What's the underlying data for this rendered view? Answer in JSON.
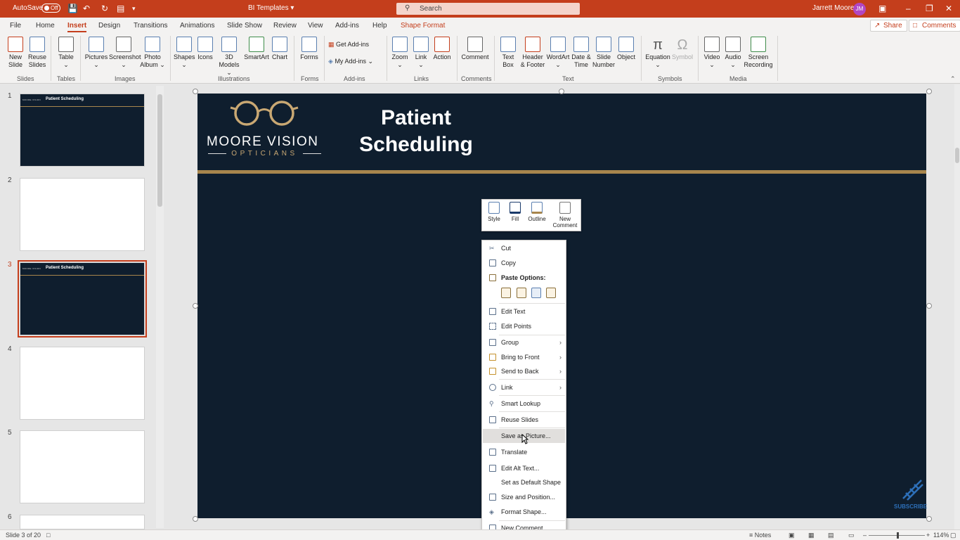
{
  "titlebar": {
    "autosave_label": "AutoSave",
    "autosave_state": "Off",
    "doc_title": "BI Templates",
    "search_placeholder": "Search",
    "user_name": "Jarrett Moore",
    "user_initials": "JM"
  },
  "tabs": [
    "File",
    "Home",
    "Insert",
    "Design",
    "Transitions",
    "Animations",
    "Slide Show",
    "Review",
    "View",
    "Add-ins",
    "Help",
    "Shape Format"
  ],
  "active_tab": "Insert",
  "top_actions": {
    "share": "Share",
    "comments": "Comments"
  },
  "ribbon": {
    "new_slide": [
      "New",
      "Slide"
    ],
    "reuse_slides": [
      "Reuse",
      "Slides"
    ],
    "table": "Table",
    "pictures": "Pictures",
    "screenshot": "Screenshot",
    "photo_album": [
      "Photo",
      "Album"
    ],
    "shapes": "Shapes",
    "icons": "Icons",
    "models": [
      "3D",
      "Models"
    ],
    "smartart": "SmartArt",
    "chart": "Chart",
    "forms": "Forms",
    "get_addins": "Get Add-ins",
    "my_addins": "My Add-ins",
    "zoom": "Zoom",
    "link": "Link",
    "action": "Action",
    "comment": "Comment",
    "text_box": [
      "Text",
      "Box"
    ],
    "header_footer": [
      "Header",
      "& Footer"
    ],
    "wordart": "WordArt",
    "date_time": [
      "Date &",
      "Time"
    ],
    "slide_number": [
      "Slide",
      "Number"
    ],
    "object": "Object",
    "equation": "Equation",
    "symbol": "Symbol",
    "video": "Video",
    "audio": "Audio",
    "screen_recording": [
      "Screen",
      "Recording"
    ],
    "groups": {
      "slides": "Slides",
      "tables": "Tables",
      "images": "Images",
      "illustrations": "Illustrations",
      "forms": "Forms",
      "addins": "Add-ins",
      "links": "Links",
      "comments": "Comments",
      "text": "Text",
      "symbols": "Symbols",
      "media": "Media"
    }
  },
  "thumbnails": [
    {
      "num": "1",
      "title": "Patient Scheduling"
    },
    {
      "num": "2"
    },
    {
      "num": "3",
      "title": "Patient Scheduling"
    },
    {
      "num": "4"
    },
    {
      "num": "5"
    },
    {
      "num": "6"
    }
  ],
  "slide": {
    "title_line1": "Patient",
    "title_line2": "Scheduling",
    "brand_line1": "MOORE VISION",
    "brand_line2": "OPTICIANS",
    "subscribe": "SUBSCRIBE"
  },
  "mini_toolbar": {
    "style": "Style",
    "fill": "Fill",
    "outline": "Outline",
    "new_comment": [
      "New",
      "Comment"
    ]
  },
  "context_menu": {
    "cut": "Cut",
    "copy": "Copy",
    "paste_options": "Paste Options:",
    "edit_text": "Edit Text",
    "edit_points": "Edit Points",
    "group": "Group",
    "bring_to_front": "Bring to Front",
    "send_to_back": "Send to Back",
    "link": "Link",
    "smart_lookup": "Smart Lookup",
    "reuse_slides": "Reuse Slides",
    "save_as_picture": "Save as Picture...",
    "translate": "Translate",
    "edit_alt_text": "Edit Alt Text...",
    "set_default_shape": "Set as Default Shape",
    "size_position": "Size and Position...",
    "format_shape": "Format Shape...",
    "new_comment": "New Comment"
  },
  "status": {
    "slide_info": "Slide 3 of 20",
    "notes": "Notes",
    "zoom": "114%"
  },
  "colors": {
    "accent": "#c43e1c",
    "slide_bg": "#0f1e2e",
    "gold": "#a8864d"
  }
}
